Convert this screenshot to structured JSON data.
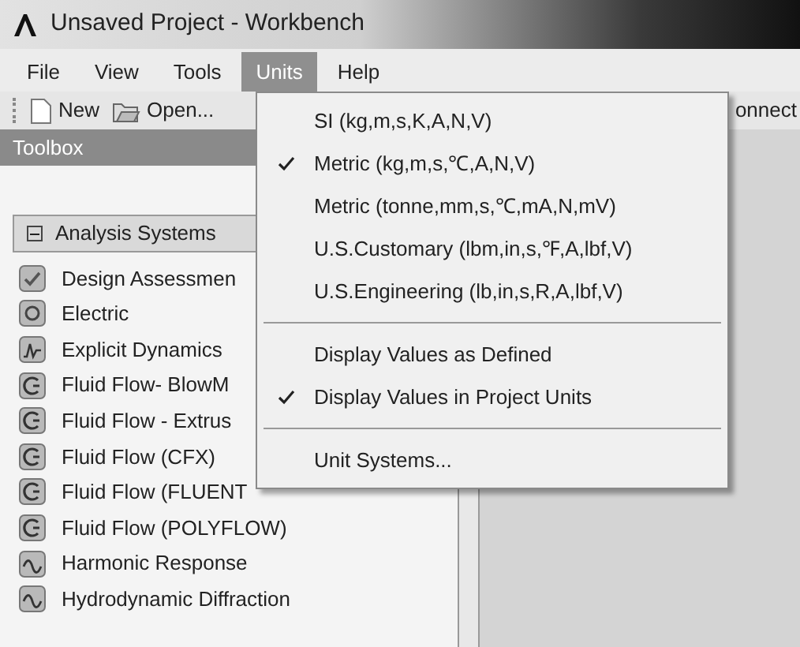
{
  "window": {
    "title": "Unsaved Project - Workbench"
  },
  "menu_bar": [
    {
      "label": "File",
      "selected": false
    },
    {
      "label": "View",
      "selected": false
    },
    {
      "label": "Tools",
      "selected": false
    },
    {
      "label": "Units",
      "selected": true
    },
    {
      "label": "Help",
      "selected": false
    }
  ],
  "toolbar": [
    {
      "label": "New",
      "kind": "new"
    },
    {
      "label": "Open...",
      "kind": "open"
    },
    {
      "label": "onnect",
      "kind": "text"
    }
  ],
  "toolbox": {
    "title": "Toolbox",
    "group": {
      "label": "Analysis Systems",
      "expanded": true,
      "items": [
        {
          "label": "Design Assessmen",
          "kind": "check"
        },
        {
          "label": "Electric",
          "kind": "circle"
        },
        {
          "label": "Explicit Dynamics",
          "kind": "spike"
        },
        {
          "label": "Fluid Flow- BlowM",
          "kind": "flow"
        },
        {
          "label": "Fluid Flow - Extrus",
          "kind": "flow"
        },
        {
          "label": "Fluid Flow (CFX)",
          "kind": "flow"
        },
        {
          "label": "Fluid Flow (FLUENT",
          "kind": "flow"
        },
        {
          "label": "Fluid Flow (POLYFLOW)",
          "kind": "flow"
        },
        {
          "label": "Harmonic Response",
          "kind": "wave"
        },
        {
          "label": "Hydrodynamic Diffraction",
          "kind": "wave"
        }
      ]
    }
  },
  "units_menu": [
    {
      "kind": "item",
      "label": "SI (kg,m,s,K,A,N,V)",
      "checked": false
    },
    {
      "kind": "item",
      "label": "Metric (kg,m,s,℃,A,N,V)",
      "checked": true
    },
    {
      "kind": "item",
      "label": "Metric (tonne,mm,s,℃,mA,N,mV)",
      "checked": false
    },
    {
      "kind": "item",
      "label": "U.S.Customary (lbm,in,s,℉,A,lbf,V)",
      "checked": false
    },
    {
      "kind": "item",
      "label": "U.S.Engineering (lb,in,s,R,A,lbf,V)",
      "checked": false
    },
    {
      "kind": "separator"
    },
    {
      "kind": "item",
      "label": "Display Values as Defined",
      "checked": false
    },
    {
      "kind": "item",
      "label": "Display Values in Project Units",
      "checked": true
    },
    {
      "kind": "separator"
    },
    {
      "kind": "item",
      "label": "Unit Systems...",
      "checked": false
    }
  ]
}
